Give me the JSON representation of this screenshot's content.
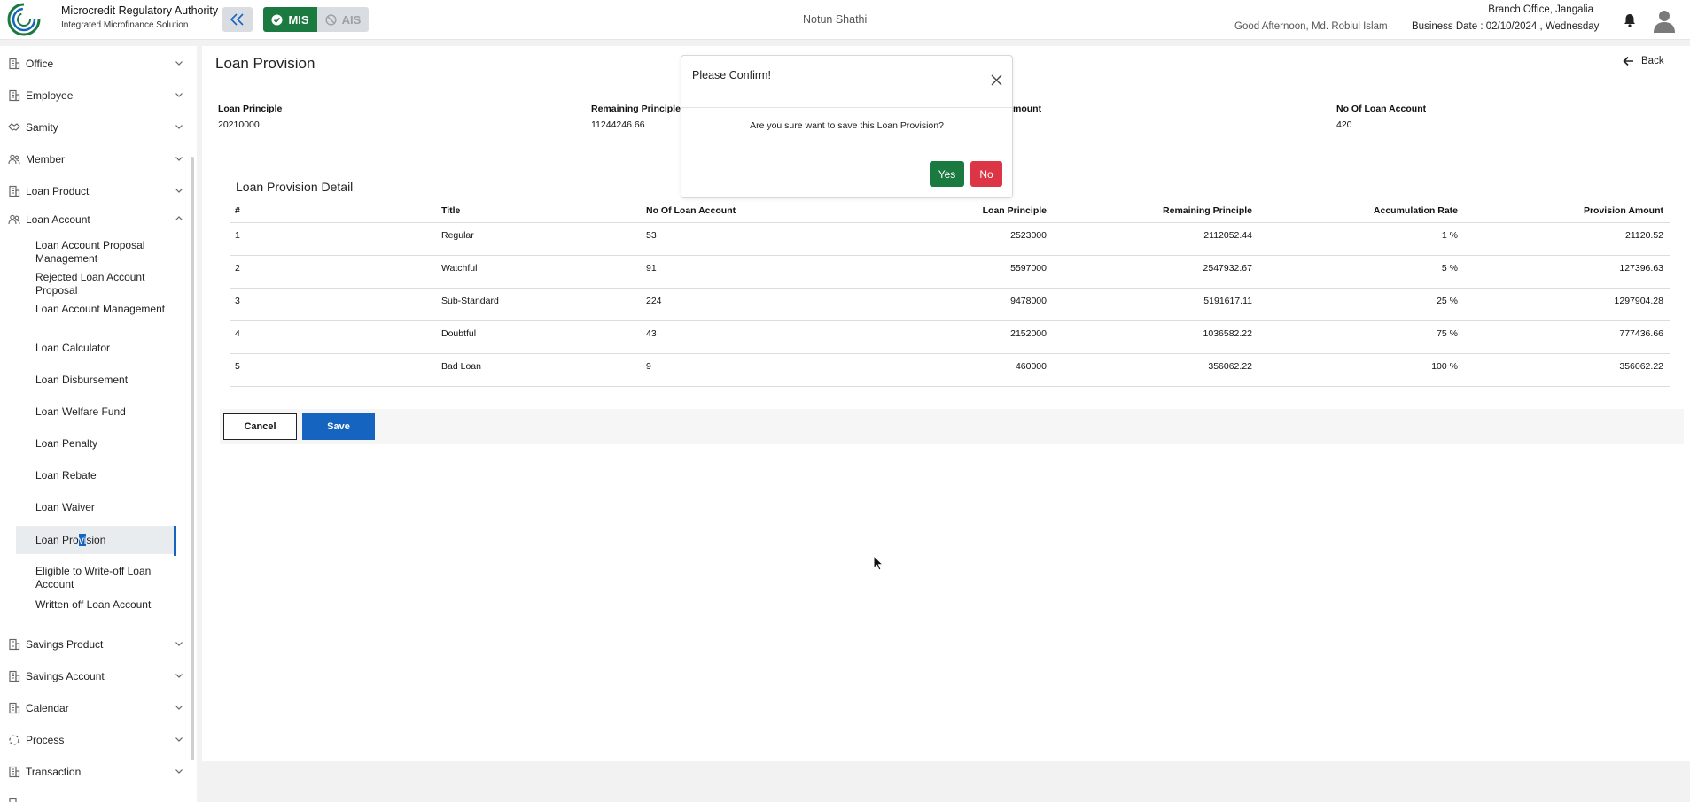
{
  "header": {
    "brand_title": "Microcredit Regulatory Authority",
    "brand_sub": "Integrated Microfinance Solution",
    "logo_text": "Microcredit Regulatory Authority",
    "mis_label": "MIS",
    "ais_label": "AIS",
    "org_name": "Notun Shathi",
    "greeting": "Good Afternoon, Md. Robiul Islam",
    "branch": "Branch Office, Jangalia",
    "business_date": "Business Date : 02/10/2024 , Wednesday"
  },
  "sidebar": {
    "items": [
      {
        "label": "Office",
        "icon": "building-icon"
      },
      {
        "label": "Employee",
        "icon": "building-icon"
      },
      {
        "label": "Samity",
        "icon": "handshake-icon"
      },
      {
        "label": "Member",
        "icon": "users-icon"
      },
      {
        "label": "Loan Product",
        "icon": "building-icon"
      },
      {
        "label": "Loan Account",
        "icon": "users-icon"
      }
    ],
    "sub_items": [
      "Loan Account Proposal Management",
      "Rejected Loan Account Proposal",
      "Loan Account Management",
      "Loan Calculator",
      "Loan Disbursement",
      "Loan Welfare Fund",
      "Loan Penalty",
      "Loan Rebate",
      "Loan Waiver",
      "Loan Provision",
      "Eligible to Write-off Loan Account",
      "Written off Loan Account"
    ],
    "active_parts": {
      "before": "Loan Pro",
      "highlight": "vi",
      "after": "sion"
    },
    "items_after": [
      {
        "label": "Savings Product",
        "icon": "building-icon"
      },
      {
        "label": "Savings Account",
        "icon": "building-icon"
      },
      {
        "label": "Calendar",
        "icon": "building-icon"
      },
      {
        "label": "Process",
        "icon": "spinner-icon"
      },
      {
        "label": "Transaction",
        "icon": "building-icon"
      }
    ]
  },
  "page": {
    "title": "Loan Provision",
    "back_label": "Back"
  },
  "summary": {
    "loan_principle_label": "Loan Principle",
    "loan_principle_value": "20210000",
    "remaining_principle_label": "Remaining Principle",
    "remaining_principle_value": "11244246.66",
    "amount_label": "mount",
    "no_of_loan_account_label": "No Of Loan Account",
    "no_of_loan_account_value": "420"
  },
  "detail": {
    "title": "Loan Provision Detail",
    "columns": [
      "#",
      "Title",
      "No Of Loan Account",
      "Loan Principle",
      "Remaining Principle",
      "Accumulation Rate",
      "Provision Amount"
    ],
    "rows": [
      [
        "1",
        "Regular",
        "53",
        "2523000",
        "2112052.44",
        "1 %",
        "21120.52"
      ],
      [
        "2",
        "Watchful",
        "91",
        "5597000",
        "2547932.67",
        "5 %",
        "127396.63"
      ],
      [
        "3",
        "Sub-Standard",
        "224",
        "9478000",
        "5191617.11",
        "25 %",
        "1297904.28"
      ],
      [
        "4",
        "Doubtful",
        "43",
        "2152000",
        "1036582.22",
        "75 %",
        "777436.66"
      ],
      [
        "5",
        "Bad Loan",
        "9",
        "460000",
        "356062.22",
        "100 %",
        "356062.22"
      ]
    ]
  },
  "actions": {
    "cancel_label": "Cancel",
    "save_label": "Save"
  },
  "modal": {
    "title": "Please Confirm!",
    "message": "Are you sure want to save this Loan Provision?",
    "yes_label": "Yes",
    "no_label": "No"
  },
  "colors": {
    "primary_blue": "#1565c0",
    "success_green": "#1b7a3f",
    "danger_red": "#dc3545"
  }
}
